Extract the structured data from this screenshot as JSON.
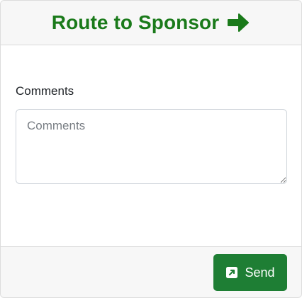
{
  "header": {
    "title": "Route to Sponsor",
    "icon": "arrow-right-icon",
    "accent_color": "#1a7a1a"
  },
  "form": {
    "comments_label": "Comments",
    "comments_placeholder": "Comments",
    "comments_value": ""
  },
  "footer": {
    "send_label": "Send",
    "send_icon": "external-link-square-icon",
    "button_color": "#1e7e34"
  }
}
